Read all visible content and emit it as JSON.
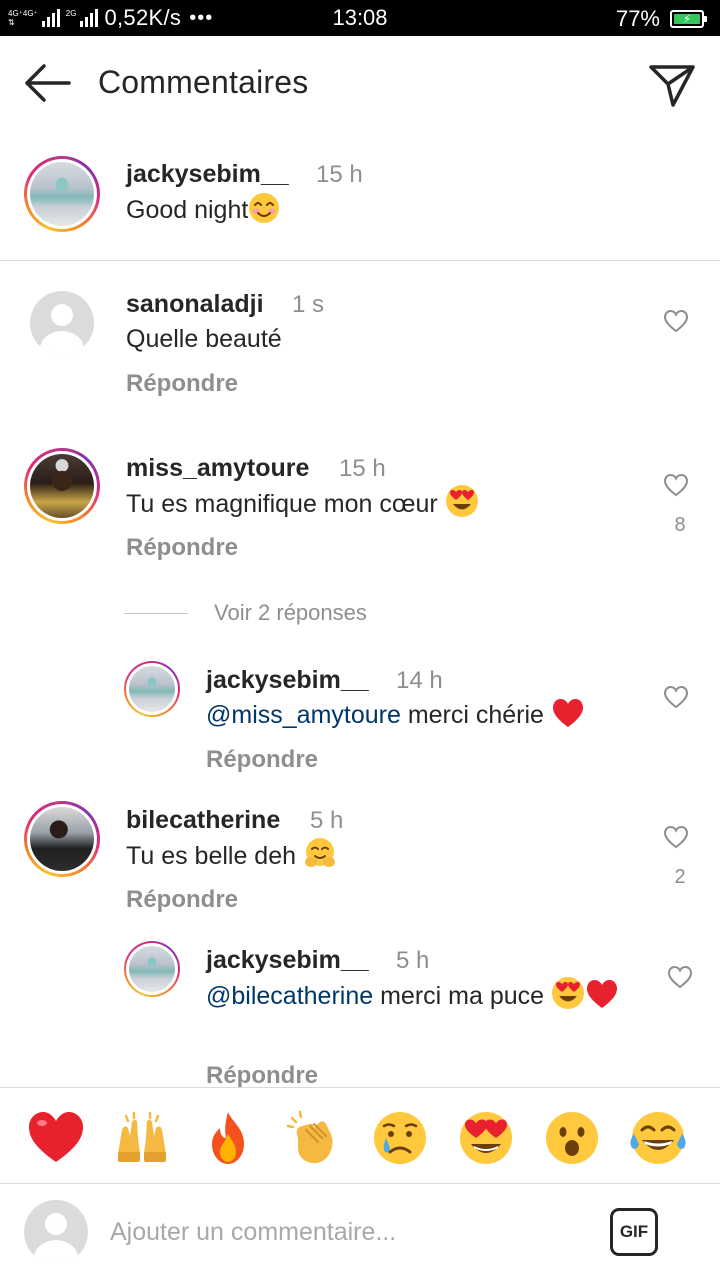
{
  "status_bar": {
    "network_top": "4G⁺4G⁺",
    "network_mid": "2G",
    "net_speed": "0,52K/s",
    "dots": "•••",
    "time": "13:08",
    "battery_percent": "77%",
    "battery_level": 0.77
  },
  "header": {
    "title": "Commentaires",
    "back_icon": "arrow-left-icon",
    "send_icon": "paper-plane-icon"
  },
  "caption": {
    "username": "jackysebim__",
    "time": "15 h",
    "text": "Good night",
    "emoji": "smiling-blush"
  },
  "comments": [
    {
      "username": "sanonaladji",
      "time": "1 s",
      "text": "Quelle beauté",
      "reply_label": "Répondre",
      "likes": ""
    },
    {
      "username": "miss_amytoure",
      "time": "15 h",
      "text": "Tu es magnifique mon cœur",
      "reply_label": "Répondre",
      "likes": "8"
    },
    {
      "username": "bilecatherine",
      "time": "5 h",
      "text": "Tu es belle deh",
      "reply_label": "Répondre",
      "likes": "2"
    }
  ],
  "view_replies": "Voir 2 réponses",
  "replies": [
    {
      "username": "jackysebim__",
      "time": "14 h",
      "mention": "@miss_amytoure",
      "text": " merci chérie",
      "reply_label": "Répondre"
    },
    {
      "username": "jackysebim__",
      "time": "5 h",
      "mention": "@bilecatherine",
      "text": " merci ma puce",
      "reply_label": "Répondre"
    }
  ],
  "quick_emojis": [
    "red-heart",
    "raising-hands",
    "fire",
    "clapping-hands",
    "crying-face",
    "heart-eyes",
    "open-mouth",
    "tears-of-joy"
  ],
  "input": {
    "placeholder": "Ajouter un commentaire...",
    "gif_label": "GIF"
  },
  "colors": {
    "text": "#262626",
    "secondary": "#8e8e8e",
    "mention": "#00376b",
    "divider": "#dbdbdb",
    "heart": "#ed1c2e"
  }
}
